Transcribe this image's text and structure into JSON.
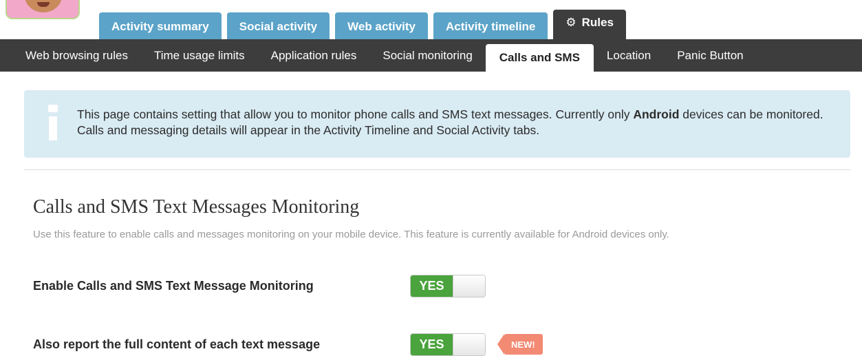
{
  "top_tabs": [
    {
      "label": "Activity summary"
    },
    {
      "label": "Social activity"
    },
    {
      "label": "Web activity"
    },
    {
      "label": "Activity timeline"
    },
    {
      "label": "Rules",
      "icon": "gear-icon",
      "active": true
    }
  ],
  "sub_nav": [
    {
      "label": "Web browsing rules"
    },
    {
      "label": "Time usage limits"
    },
    {
      "label": "Application rules"
    },
    {
      "label": "Social monitoring"
    },
    {
      "label": "Calls and SMS",
      "active": true
    },
    {
      "label": "Location"
    },
    {
      "label": "Panic Button"
    }
  ],
  "info": {
    "icon": "info-icon",
    "text_before": "This page contains setting that allow you to monitor phone calls and SMS text messages. Currently only ",
    "text_bold": "Android",
    "text_after": " devices can be monitored. Calls and messaging details will appear in the Activity Timeline and Social Activity tabs."
  },
  "section": {
    "title": "Calls and SMS Text Messages Monitoring",
    "description": "Use this feature to enable calls and messages monitoring on your mobile device. This feature is currently available for Android devices only."
  },
  "settings": [
    {
      "label": "Enable Calls and SMS Text Message Monitoring",
      "toggle_label": "YES",
      "enabled": true
    },
    {
      "label": "Also report the full content of each text message",
      "toggle_label": "YES",
      "enabled": true,
      "badge": "NEW!"
    }
  ],
  "colors": {
    "tab_blue": "#5ba3c8",
    "nav_dark": "#3d3d3d",
    "info_bg": "#d9ebf3",
    "toggle_green": "#4aa33c",
    "badge_salmon": "#f28a74"
  }
}
